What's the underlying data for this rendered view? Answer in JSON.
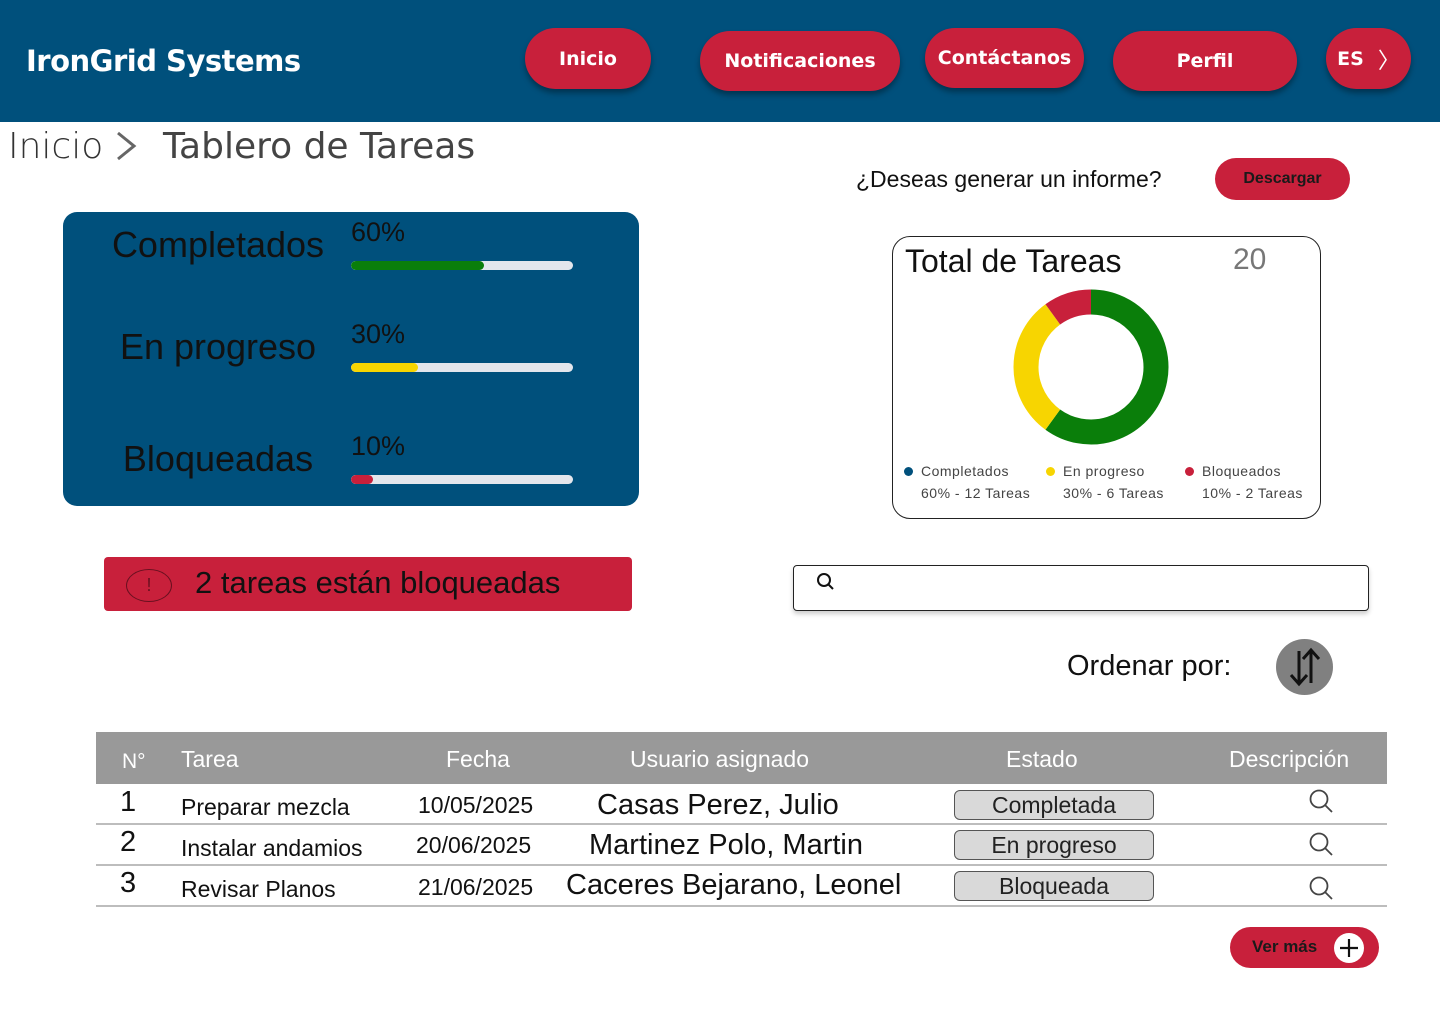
{
  "header": {
    "brand": "IronGrid Systems",
    "nav": [
      "Inicio",
      "Notificaciones",
      "Contáctanos",
      "Perfil"
    ],
    "language": "ES"
  },
  "breadcrumb": {
    "home": "Inicio",
    "current": "Tablero de Tareas"
  },
  "report": {
    "question": "¿Deseas generar un informe?",
    "button": "Descargar"
  },
  "progress": [
    {
      "label": "Completados",
      "percent_text": "60%",
      "fraction": 0.6,
      "color": "#0a7e0a"
    },
    {
      "label": "En progreso",
      "percent_text": "30%",
      "fraction": 0.3,
      "color": "#f7d501"
    },
    {
      "label": "Bloqueadas",
      "percent_text": "10%",
      "fraction": 0.1,
      "color": "#c8203b"
    }
  ],
  "summary": {
    "title": "Total de Tareas",
    "total": "20",
    "legend": [
      {
        "name": "Completados",
        "detail": "60% - 12 Tareas",
        "color": "#00507c"
      },
      {
        "name": "En progreso",
        "detail": "30% - 6 Tareas",
        "color": "#f7d501"
      },
      {
        "name": "Bloqueados",
        "detail": "10% - 2 Tareas",
        "color": "#c8203b"
      }
    ]
  },
  "chart_data": {
    "type": "pie",
    "categories": [
      "Completados",
      "En progreso",
      "Bloqueados"
    ],
    "values": [
      12,
      6,
      2
    ],
    "colors": [
      "#0a7e0a",
      "#f7d501",
      "#c8203b"
    ],
    "title": "Total de Tareas"
  },
  "alert": {
    "text": "2 tareas están bloqueadas",
    "icon": "!"
  },
  "search": {
    "placeholder": ""
  },
  "sort": {
    "label": "Ordenar por:"
  },
  "table": {
    "headers": [
      "N°",
      "Tarea",
      "Fecha",
      "Usuario asignado",
      "Estado",
      "Descripción"
    ],
    "rows": [
      {
        "num": "1",
        "task": "Preparar mezcla",
        "date": "10/05/2025",
        "user": "Casas Perez, Julio",
        "status": "Completada"
      },
      {
        "num": "2",
        "task": "Instalar andamios",
        "date": "20/06/2025",
        "user": "Martinez Polo, Martin",
        "status": "En progreso"
      },
      {
        "num": "3",
        "task": "Revisar Planos",
        "date": "21/06/2025",
        "user": "Caceres Bejarano, Leonel",
        "status": "Bloqueada"
      }
    ]
  },
  "more": {
    "label": "Ver más"
  }
}
